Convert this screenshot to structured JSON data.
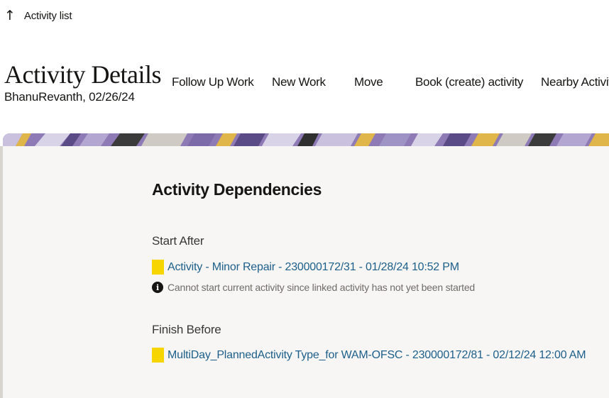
{
  "nav": {
    "back_icon": "arrow-up-icon",
    "back_label": "Activity list"
  },
  "header": {
    "title": "Activity Details",
    "subtitle": "BhanuRevanth, 02/26/24"
  },
  "actions": [
    {
      "label": "Follow Up Work"
    },
    {
      "label": "New Work"
    },
    {
      "label": "Move"
    },
    {
      "label": "Book (create) activity"
    },
    {
      "label": "Nearby Activities"
    }
  ],
  "dependencies": {
    "title": "Activity Dependencies",
    "start_after": {
      "label": "Start After",
      "link": "Activity - Minor Repair - 230000172/31 - 01/28/24 10:52 PM",
      "note": "Cannot start current activity since linked activity has not yet been started",
      "note_icon": "info-icon"
    },
    "finish_before": {
      "label": "Finish Before",
      "link": "MultiDay_PlannedActivity Type_for WAM-OFSC - 230000172/81 - 02/12/24 12:00 AM"
    }
  },
  "colors": {
    "accent_link": "#1d5f8a",
    "status_swatch": "#f6d500",
    "banner_purple": "#8e7bb5"
  }
}
